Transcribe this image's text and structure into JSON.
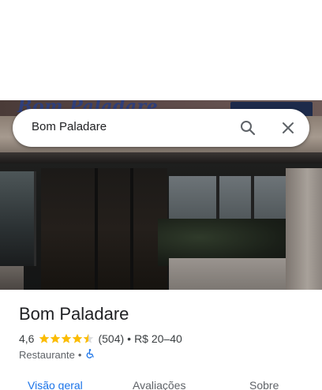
{
  "search": {
    "query": "Bom Paladare"
  },
  "photo": {
    "sign_text": "Bom Paladare"
  },
  "place": {
    "name": "Bom Paladare",
    "rating": "4,6",
    "stars": 4.5,
    "review_count": "(504)",
    "separator": "•",
    "price_range": "R$ 20–40",
    "category": "Restaurante",
    "category_separator": "•"
  },
  "tabs": [
    {
      "label": "Visão geral",
      "active": true
    },
    {
      "label": "Avaliações",
      "active": false
    },
    {
      "label": "Sobre",
      "active": false
    }
  ],
  "colors": {
    "accent": "#1a73e8",
    "star": "#fbbc04",
    "accessibility": "#1a73e8"
  },
  "icons": {
    "search": "search-icon",
    "close": "close-icon",
    "accessibility": "wheelchair-icon"
  }
}
